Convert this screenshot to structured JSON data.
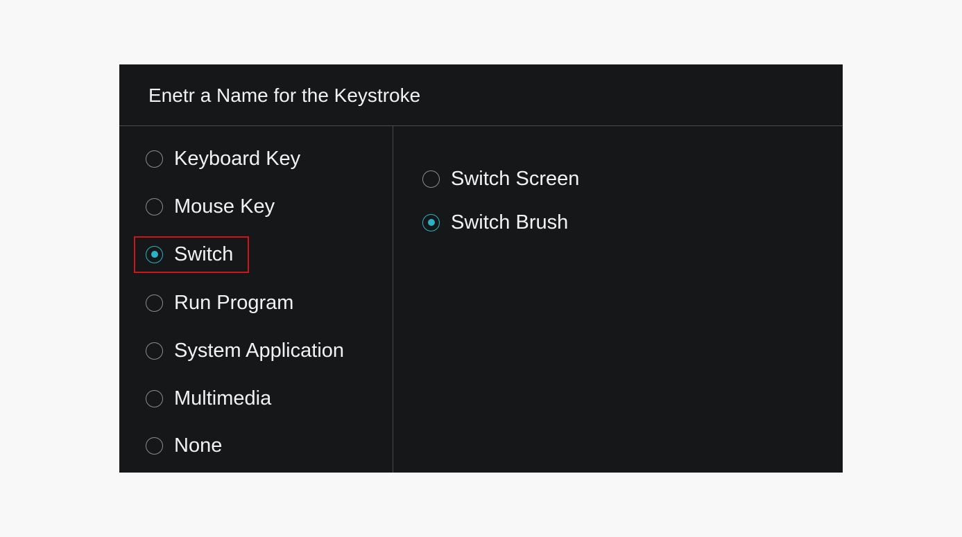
{
  "dialog": {
    "title": "Enetr a Name for the Keystroke"
  },
  "key_types": [
    {
      "label": "Keyboard Key",
      "checked": false
    },
    {
      "label": "Mouse Key",
      "checked": false
    },
    {
      "label": "Switch",
      "checked": true
    },
    {
      "label": "Run Program",
      "checked": false
    },
    {
      "label": "System Application",
      "checked": false
    },
    {
      "label": "Multimedia",
      "checked": false
    },
    {
      "label": "None",
      "checked": false
    }
  ],
  "switch_options": [
    {
      "label": "Switch Screen",
      "checked": false
    },
    {
      "label": "Switch Brush",
      "checked": true
    }
  ],
  "colors": {
    "accent": "#2ab3c6",
    "highlight": "#d0141c",
    "panel_bg": "#161719",
    "page_bg": "#f8f8f8"
  },
  "annotation": {
    "highlighted_option": "Switch"
  }
}
